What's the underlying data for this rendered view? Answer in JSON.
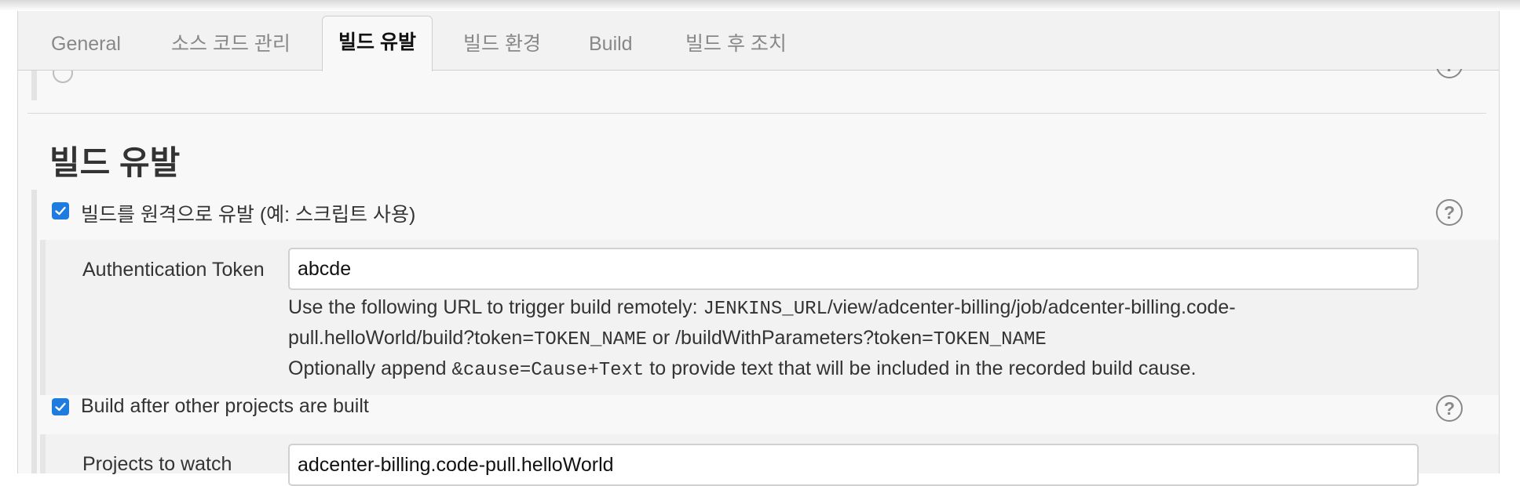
{
  "tabs": [
    {
      "label": "General",
      "active": false
    },
    {
      "label": "소스 코드 관리",
      "active": false
    },
    {
      "label": "빌드 유발",
      "active": true
    },
    {
      "label": "빌드 환경",
      "active": false
    },
    {
      "label": "Build",
      "active": false
    },
    {
      "label": "빌드 후 조치",
      "active": false
    }
  ],
  "section": {
    "title": "빌드 유발"
  },
  "trigger_remote": {
    "checked": true,
    "label": "빌드를 원격으로 유발 (예: 스크립트 사용)",
    "help_icon": "question-circle-icon",
    "token_label": "Authentication Token",
    "token_value": "abcde",
    "desc_line1_prefix": "Use the following URL to trigger build remotely: ",
    "desc_jenkins_url": "JENKINS_URL",
    "desc_line1_path": "/view/adcenter-billing/job/adcenter-billing.code-",
    "desc_line2_prefix": "pull.helloWorld/build?token=",
    "desc_token_name_1": "TOKEN_NAME",
    "desc_line2_mid": " or /buildWithParameters?token=",
    "desc_token_name_2": "TOKEN_NAME",
    "desc_line3_prefix": "Optionally append ",
    "desc_cause": "&cause=Cause+Text",
    "desc_line3_suffix": " to provide text that will be included in the recorded build cause."
  },
  "build_after": {
    "checked": true,
    "label": "Build after other projects are built",
    "help_icon": "question-circle-icon",
    "projects_label_partial": "Projects to watch",
    "projects_value_partial": "adcenter-billing.code-pull.helloWorld"
  },
  "colors": {
    "accent": "#1e7ce0",
    "panel": "#f8f8f8",
    "border": "#cfcfcf"
  }
}
